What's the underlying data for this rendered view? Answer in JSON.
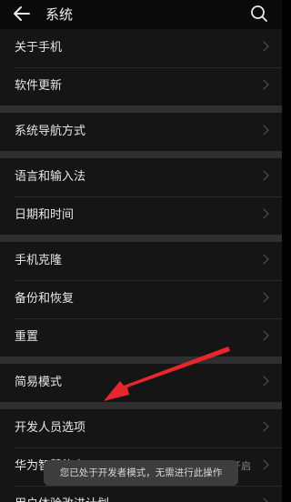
{
  "header": {
    "title": "系统"
  },
  "groups": [
    [
      {
        "label": "关于手机"
      },
      {
        "label": "软件更新"
      }
    ],
    [
      {
        "label": "系统导航方式"
      }
    ],
    [
      {
        "label": "语言和输入法"
      },
      {
        "label": "日期和时间"
      }
    ],
    [
      {
        "label": "手机克隆"
      },
      {
        "label": "备份和恢复"
      },
      {
        "label": "重置"
      }
    ],
    [
      {
        "label": "简易模式"
      }
    ],
    [
      {
        "label": "开发人员选项"
      },
      {
        "label": "华为智慧能力",
        "value": "已开启"
      },
      {
        "label": "用户体验改进计划"
      }
    ]
  ],
  "toast": {
    "text": "您已处于开发者模式，无需进行此操作"
  },
  "colors": {
    "annotation_arrow": "#e8262e",
    "background": "#000000",
    "row_bg": "#151515",
    "group_gap": "#2f2f2f"
  }
}
